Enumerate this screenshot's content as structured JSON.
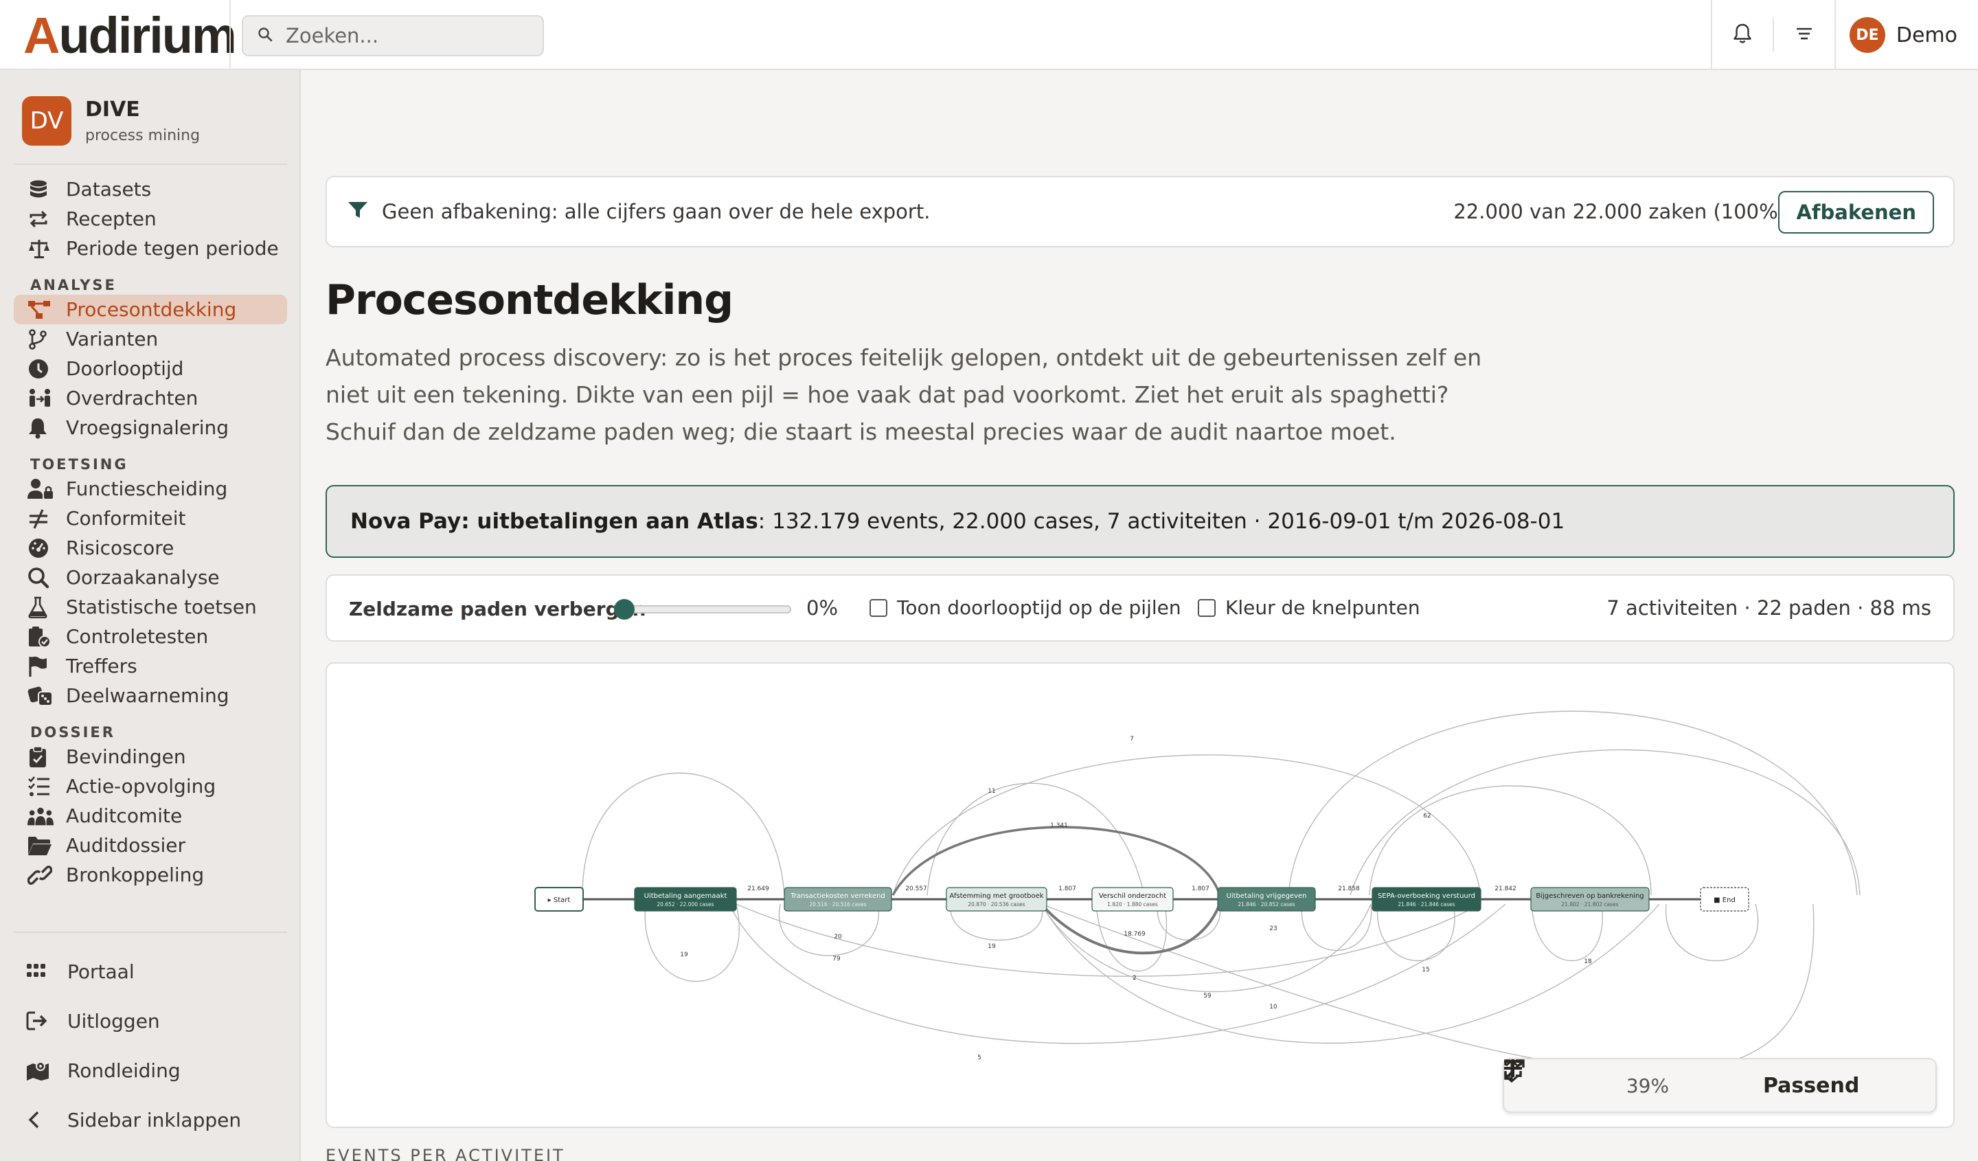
{
  "app": {
    "logo_prefix": "A",
    "logo_rest": "udirium"
  },
  "search": {
    "placeholder": "Zoeken..."
  },
  "user": {
    "initials": "DE",
    "name": "Demo"
  },
  "project": {
    "initials": "DV",
    "name": "DIVE",
    "subtitle": "process mining"
  },
  "nav_top": [
    {
      "label": "Datasets",
      "icon": "database-icon"
    },
    {
      "label": "Recepten",
      "icon": "repeat-icon"
    },
    {
      "label": "Periode tegen periode",
      "icon": "scale-icon"
    }
  ],
  "sections": {
    "analyse": "ANALYSE",
    "toetsing": "TOETSING",
    "dossier": "DOSSIER"
  },
  "nav_analyse": [
    {
      "label": "Procesontdekking",
      "icon": "process-graph-icon",
      "active": true
    },
    {
      "label": "Varianten",
      "icon": "branch-icon"
    },
    {
      "label": "Doorlooptijd",
      "icon": "clock-icon"
    },
    {
      "label": "Overdrachten",
      "icon": "handover-icon"
    },
    {
      "label": "Vroegsignalering",
      "icon": "bell-icon"
    }
  ],
  "nav_toetsing": [
    {
      "label": "Functiescheiding",
      "icon": "user-lock-icon"
    },
    {
      "label": "Conformiteit",
      "icon": "not-equal-icon"
    },
    {
      "label": "Risicoscore",
      "icon": "gauge-icon"
    },
    {
      "label": "Oorzaakanalyse",
      "icon": "magnify-icon"
    },
    {
      "label": "Statistische toetsen",
      "icon": "flask-icon"
    },
    {
      "label": "Controletesten",
      "icon": "clipboard-check-icon"
    },
    {
      "label": "Treffers",
      "icon": "flag-icon"
    },
    {
      "label": "Deelwaarneming",
      "icon": "dice-icon"
    }
  ],
  "nav_dossier": [
    {
      "label": "Bevindingen",
      "icon": "clipboard-icon"
    },
    {
      "label": "Actie-opvolging",
      "icon": "checklist-icon"
    },
    {
      "label": "Auditcomite",
      "icon": "people-icon"
    },
    {
      "label": "Auditdossier",
      "icon": "folder-icon"
    },
    {
      "label": "Bronkoppeling",
      "icon": "link-icon"
    }
  ],
  "footer": {
    "portal": "Portaal",
    "logout": "Uitloggen",
    "tour": "Rondleiding",
    "collapse": "Sidebar inklappen"
  },
  "filter": {
    "text": "Geen afbakening: alle cijfers gaan over de hele export.",
    "count": "22.000 van 22.000 zaken (100%)",
    "button": "Afbakenen"
  },
  "page": {
    "title": "Procesontdekking",
    "description": "Automated process discovery: zo is het proces feitelijk gelopen, ontdekt uit de gebeurtenissen zelf en niet uit een tekening. Dikte van een pijl = hoe vaak dat pad voorkomt. Ziet het eruit als spaghetti? Schuif dan de zeldzame paden weg; die staart is meestal precies waar de audit naartoe moet."
  },
  "dataset": {
    "name": "Nova Pay: uitbetalingen aan Atlas",
    "stats": ": 132.179 events, 22.000 cases, 7 activiteiten · 2016-09-01 t/m 2026-08-01"
  },
  "controls": {
    "rare_label": "Zeldzame paden verbergen",
    "rare_value": "0%",
    "rare_fraction": 0,
    "show_duration_label": "Toon doorlooptijd op de pijlen",
    "show_duration_checked": false,
    "color_bottlenecks_label": "Kleur de knelpunten",
    "color_bottlenecks_checked": false,
    "stats": "7 activiteiten · 22 paden · 88 ms"
  },
  "graph": {
    "start_label": "▸ Start",
    "end_label": "■ End",
    "nodes": [
      {
        "name": "Uitbetaling aangemaakt",
        "sub": "20.652 · 22.000 cases",
        "color": "#2f5f52"
      },
      {
        "name": "Transactiekosten verrekend",
        "sub": "20.516 · 20.516 cases",
        "color": "#8aa89f"
      },
      {
        "name": "Afstemming met grootboek",
        "sub": "20.870 · 20.536 cases",
        "color": "#dfe9e5"
      },
      {
        "name": "Verschil onderzocht",
        "sub": "1.820 · 1.880 cases",
        "color": "#f4f7f6"
      },
      {
        "name": "Uitbetaling vrijgegeven",
        "sub": "21.846 · 20.852 cases",
        "color": "#527f73"
      },
      {
        "name": "SEPA-overboeking verstuurd",
        "sub": "21.846 · 21.846 cases",
        "color": "#2f5f52"
      },
      {
        "name": "Bijgeschreven op bankrekening",
        "sub": "21.802 · 21.802 cases",
        "color": "#a7bfb8"
      }
    ],
    "edge_labels": {
      "main": [
        "21.649",
        "20.557",
        "1.807",
        "1.807",
        "21.858",
        "21.842"
      ],
      "others": [
        "7",
        "11",
        "1.341",
        "62",
        "19",
        "20",
        "79",
        "19",
        "18.769",
        "23",
        "2",
        "59",
        "10",
        "15",
        "18",
        "5"
      ]
    }
  },
  "zoom": {
    "percent": "39%",
    "fit_label": "Passend"
  },
  "next_section": "EVENTS PER ACTIVITEIT"
}
